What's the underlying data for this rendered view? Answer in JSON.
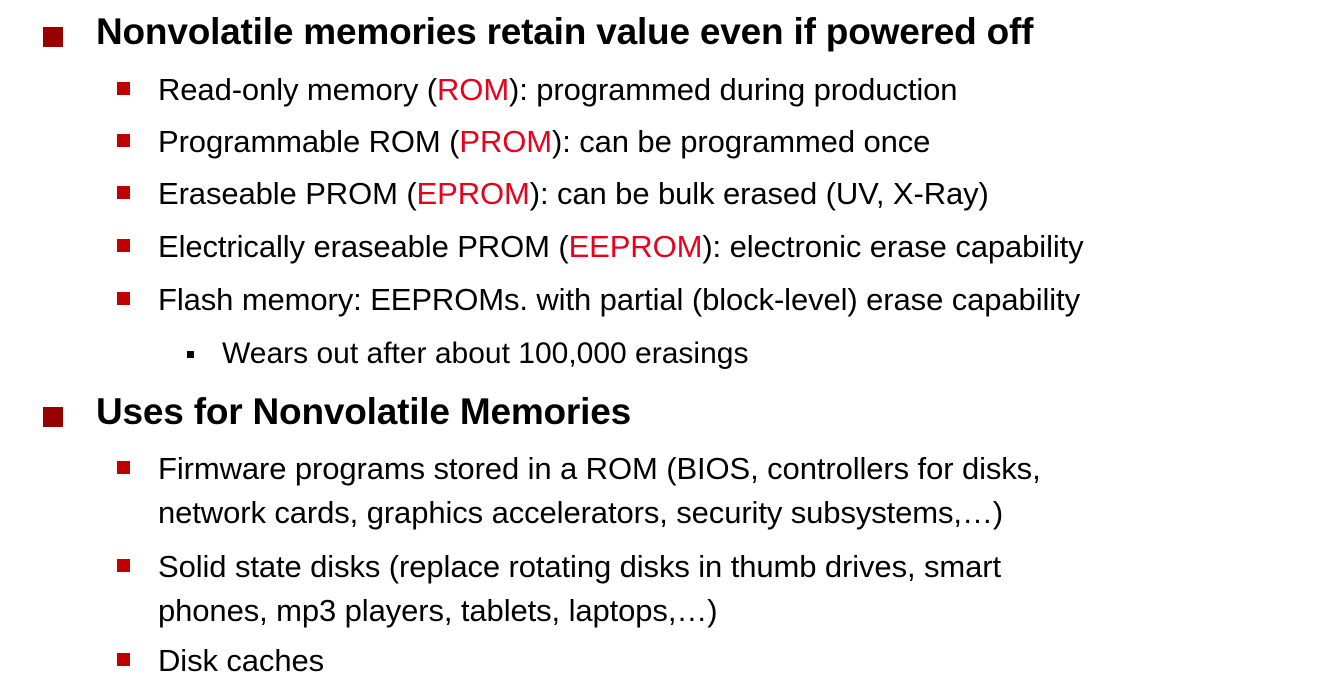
{
  "colors": {
    "level1_bullet": "#990000",
    "level2_bullet": "#c00000",
    "acronym": "#e8001c"
  },
  "sections": [
    {
      "heading": "Nonvolatile memories retain value even if powered off",
      "items": [
        {
          "before": "Read-only memory (",
          "acronym": "ROM",
          "after": "): programmed during production"
        },
        {
          "before": "Programmable ROM (",
          "acronym": "PROM",
          "after": "): can be programmed once"
        },
        {
          "before": "Eraseable PROM (",
          "acronym": "EPROM",
          "after": "): can be bulk erased (UV, X-Ray)"
        },
        {
          "before": "Electrically eraseable PROM (",
          "acronym": "EEPROM",
          "after": "): electronic erase capability"
        },
        {
          "text": "Flash memory: EEPROMs. with partial (block-level) erase capability",
          "subitems": [
            "Wears out after about 100,000 erasings"
          ]
        }
      ]
    },
    {
      "heading": "Uses for Nonvolatile Memories",
      "items": [
        {
          "lines": [
            "Firmware programs stored in a ROM (BIOS, controllers for disks,",
            "network cards, graphics accelerators, security subsystems,…)"
          ]
        },
        {
          "lines": [
            "Solid state disks (replace rotating disks in thumb drives, smart",
            "phones, mp3 players, tablets, laptops,…)"
          ]
        },
        {
          "text": "Disk caches"
        }
      ]
    }
  ]
}
